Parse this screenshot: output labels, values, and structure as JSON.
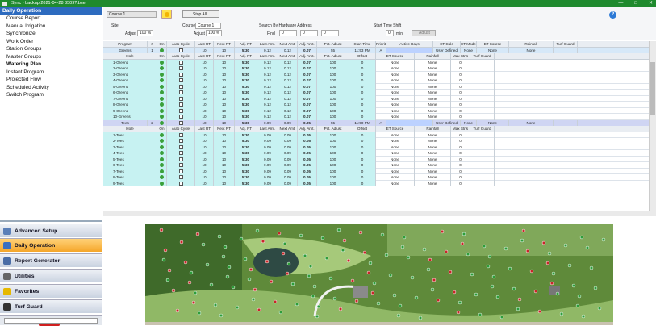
{
  "window": {
    "title": "Sync - backup 2021-04-28 3509?.bse",
    "controls": [
      "—",
      "□",
      "✕"
    ]
  },
  "sidebar": {
    "header": "Daily Operation",
    "items": [
      {
        "label": "Course Report",
        "bold": false
      },
      {
        "label": "Manual Irrigation",
        "bold": false
      },
      {
        "label": "Synchronize",
        "bold": false
      },
      {
        "label": "Work Order",
        "bold": false
      },
      {
        "label": "Station Groups",
        "bold": false
      },
      {
        "label": "Master Groups",
        "bold": false
      },
      {
        "label": "Watering Plan",
        "bold": true
      },
      {
        "label": "Instant Program",
        "bold": false
      },
      {
        "label": "Projected Flow",
        "bold": false
      },
      {
        "label": "Scheduled Activity",
        "bold": false
      },
      {
        "label": "Switch Program",
        "bold": false
      }
    ],
    "nav": [
      {
        "label": "Advanced Setup",
        "active": false,
        "icon": "settings-icon",
        "color": "#5a7fb8"
      },
      {
        "label": "Daily Operation",
        "active": true,
        "icon": "calendar-icon",
        "color": "#3a6fc0"
      },
      {
        "label": "Report Generator",
        "active": false,
        "icon": "report-icon",
        "color": "#4a6da6"
      },
      {
        "label": "Utilities",
        "active": false,
        "icon": "tools-icon",
        "color": "#666"
      },
      {
        "label": "Favorites",
        "active": false,
        "icon": "star-icon",
        "color": "#e6b800"
      },
      {
        "label": "Turf Guard",
        "active": false,
        "icon": "turf-guard-icon",
        "color": "#333"
      }
    ]
  },
  "toolbar": {
    "course_field": "Course 1",
    "stop_label": "Stop All",
    "site_label": "Site",
    "site_adjust_label": "Adjust",
    "site_adjust_value": "100 %",
    "course_label": "Course",
    "course_value": "Course 1",
    "course_adjust_label": "Adjust",
    "course_adjust_value": "100 %",
    "search_label": "Search By Hardware Address",
    "find_label": "Find",
    "find_values": [
      "0",
      "0",
      "0"
    ],
    "start_shift_label": "Start Time Shift",
    "shift_value": "0",
    "shift_unit": "min",
    "adjust_button": "Adjust"
  },
  "table": {
    "program_headers": [
      "Program",
      "#",
      "On",
      "Auto Cycle",
      "Last RT",
      "Next RT",
      "Adj. RT",
      "Last Amt.",
      "Next Amt.",
      "Adj. Amt.",
      "Pct. Adjust",
      "Start Time",
      "Priority",
      "Active Days",
      "ET Calc",
      "ET Mode",
      "ET Source",
      "Rainfall",
      "Turf Guard"
    ],
    "hole_headers": [
      "Hole",
      "On",
      "Auto Cycle",
      "Last RT",
      "Next RT",
      "Adj. RT",
      "Last Amt.",
      "Next Amt.",
      "Adj. Amt.",
      "Pct. Adjust",
      "Offset",
      "ET Source",
      "Rainfall",
      "Max Stns",
      "Turf Guard"
    ],
    "programs": [
      {
        "name": "Greens",
        "num": "1",
        "last_rt": "10",
        "next_rt": "10",
        "adj_rt": "5:30",
        "last_amt": "0.12",
        "next_amt": "0.12",
        "adj_amt": "0.07",
        "pct": "55",
        "start": "11:53 PM",
        "priority": "A",
        "et_calc": "User Defined",
        "et_mode": "None",
        "et_source": "None",
        "rainfall": "None",
        "turf_guard": "",
        "holes": [
          {
            "name": "1-Greens",
            "last_rt": "10",
            "next_rt": "10",
            "adj_rt": "5:30",
            "last_amt": "0.12",
            "next_amt": "0.12",
            "adj_amt": "0.07",
            "pct": "100",
            "offset": "0",
            "et_source": "None",
            "rainfall": "None",
            "max": "0"
          },
          {
            "name": "2-Greens",
            "last_rt": "10",
            "next_rt": "10",
            "adj_rt": "5:30",
            "last_amt": "0.12",
            "next_amt": "0.12",
            "adj_amt": "0.07",
            "pct": "100",
            "offset": "0",
            "et_source": "None",
            "rainfall": "None",
            "max": "0"
          },
          {
            "name": "3-Greens",
            "last_rt": "10",
            "next_rt": "10",
            "adj_rt": "5:30",
            "last_amt": "0.12",
            "next_amt": "0.12",
            "adj_amt": "0.07",
            "pct": "100",
            "offset": "0",
            "et_source": "None",
            "rainfall": "None",
            "max": "0"
          },
          {
            "name": "4-Greens",
            "last_rt": "10",
            "next_rt": "10",
            "adj_rt": "5:30",
            "last_amt": "0.12",
            "next_amt": "0.12",
            "adj_amt": "0.07",
            "pct": "100",
            "offset": "0",
            "et_source": "None",
            "rainfall": "None",
            "max": "0"
          },
          {
            "name": "5-Greens",
            "last_rt": "10",
            "next_rt": "10",
            "adj_rt": "5:30",
            "last_amt": "0.12",
            "next_amt": "0.12",
            "adj_amt": "0.07",
            "pct": "100",
            "offset": "0",
            "et_source": "None",
            "rainfall": "None",
            "max": "0"
          },
          {
            "name": "6-Greens",
            "last_rt": "10",
            "next_rt": "10",
            "adj_rt": "5:30",
            "last_amt": "0.12",
            "next_amt": "0.12",
            "adj_amt": "0.07",
            "pct": "100",
            "offset": "0",
            "et_source": "None",
            "rainfall": "None",
            "max": "0"
          },
          {
            "name": "7-Greens",
            "last_rt": "10",
            "next_rt": "10",
            "adj_rt": "5:30",
            "last_amt": "0.12",
            "next_amt": "0.12",
            "adj_amt": "0.07",
            "pct": "100",
            "offset": "0",
            "et_source": "None",
            "rainfall": "None",
            "max": "0"
          },
          {
            "name": "8-Greens",
            "last_rt": "10",
            "next_rt": "10",
            "adj_rt": "5:30",
            "last_amt": "0.12",
            "next_amt": "0.12",
            "adj_amt": "0.07",
            "pct": "100",
            "offset": "0",
            "et_source": "None",
            "rainfall": "None",
            "max": "0"
          },
          {
            "name": "9-Greens",
            "last_rt": "10",
            "next_rt": "10",
            "adj_rt": "5:30",
            "last_amt": "0.12",
            "next_amt": "0.12",
            "adj_amt": "0.07",
            "pct": "100",
            "offset": "0",
            "et_source": "None",
            "rainfall": "None",
            "max": "0"
          },
          {
            "name": "10-Greens",
            "last_rt": "10",
            "next_rt": "10",
            "adj_rt": "5:30",
            "last_amt": "0.12",
            "next_amt": "0.12",
            "adj_amt": "0.07",
            "pct": "100",
            "offset": "0",
            "et_source": "None",
            "rainfall": "None",
            "max": "0"
          }
        ]
      },
      {
        "name": "Tees",
        "num": "2",
        "last_rt": "10",
        "next_rt": "10",
        "adj_rt": "5:30",
        "last_amt": "0.09",
        "next_amt": "0.09",
        "adj_amt": "0.05",
        "pct": "55",
        "start": "11:50 PM",
        "priority": "A",
        "et_calc": "User Defined",
        "et_mode": "None",
        "et_source": "None",
        "rainfall": "None",
        "turf_guard": "",
        "holes": [
          {
            "name": "1-Tees",
            "last_rt": "10",
            "next_rt": "10",
            "adj_rt": "5:30",
            "last_amt": "0.09",
            "next_amt": "0.09",
            "adj_amt": "0.05",
            "pct": "100",
            "offset": "0",
            "et_source": "None",
            "rainfall": "None",
            "max": "0"
          },
          {
            "name": "2-Tees",
            "last_rt": "10",
            "next_rt": "10",
            "adj_rt": "5:30",
            "last_amt": "0.09",
            "next_amt": "0.09",
            "adj_amt": "0.05",
            "pct": "100",
            "offset": "0",
            "et_source": "None",
            "rainfall": "None",
            "max": "0"
          },
          {
            "name": "3-Tees",
            "last_rt": "10",
            "next_rt": "10",
            "adj_rt": "5:30",
            "last_amt": "0.09",
            "next_amt": "0.09",
            "adj_amt": "0.05",
            "pct": "100",
            "offset": "0",
            "et_source": "None",
            "rainfall": "None",
            "max": "0"
          },
          {
            "name": "4-Tees",
            "last_rt": "10",
            "next_rt": "10",
            "adj_rt": "5:30",
            "last_amt": "0.09",
            "next_amt": "0.09",
            "adj_amt": "0.05",
            "pct": "100",
            "offset": "0",
            "et_source": "None",
            "rainfall": "None",
            "max": "0"
          },
          {
            "name": "5-Tees",
            "last_rt": "10",
            "next_rt": "10",
            "adj_rt": "5:30",
            "last_amt": "0.09",
            "next_amt": "0.09",
            "adj_amt": "0.05",
            "pct": "100",
            "offset": "0",
            "et_source": "None",
            "rainfall": "None",
            "max": "0"
          },
          {
            "name": "6-Tees",
            "last_rt": "10",
            "next_rt": "10",
            "adj_rt": "5:30",
            "last_amt": "0.09",
            "next_amt": "0.09",
            "adj_amt": "0.05",
            "pct": "100",
            "offset": "0",
            "et_source": "None",
            "rainfall": "None",
            "max": "0"
          },
          {
            "name": "7-Tees",
            "last_rt": "10",
            "next_rt": "10",
            "adj_rt": "5:30",
            "last_amt": "0.09",
            "next_amt": "0.09",
            "adj_amt": "0.05",
            "pct": "100",
            "offset": "0",
            "et_source": "None",
            "rainfall": "None",
            "max": "0"
          },
          {
            "name": "8-Tees",
            "last_rt": "10",
            "next_rt": "10",
            "adj_rt": "5:30",
            "last_amt": "0.09",
            "next_amt": "0.09",
            "adj_amt": "0.05",
            "pct": "100",
            "offset": "0",
            "et_source": "None",
            "rainfall": "None",
            "max": "0"
          },
          {
            "name": "9-Tees",
            "last_rt": "10",
            "next_rt": "10",
            "adj_rt": "5:30",
            "last_amt": "0.09",
            "next_amt": "0.09",
            "adj_amt": "0.05",
            "pct": "100",
            "offset": "0",
            "et_source": "None",
            "rainfall": "None",
            "max": "0"
          }
        ]
      }
    ]
  },
  "colors": {
    "titlebar": "#1f8a2e",
    "sidebar_header": "#2d6bbf",
    "active_nav": "#f5a62a",
    "hole_rows": "#c7f2f2",
    "tees_row": "#cfd5f3"
  }
}
